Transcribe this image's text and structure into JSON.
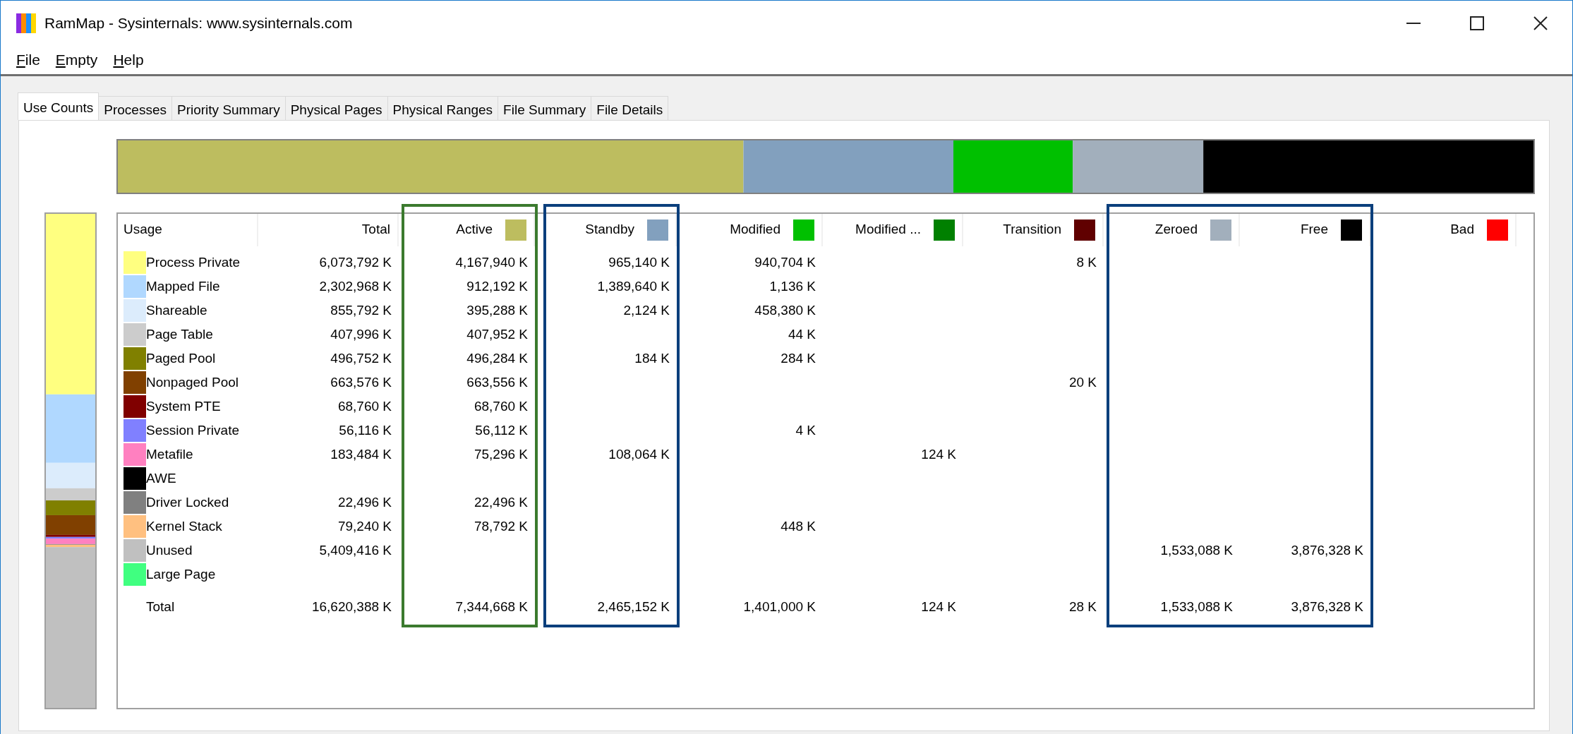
{
  "window": {
    "title": "RamMap - Sysinternals: www.sysinternals.com"
  },
  "menu": [
    {
      "label": "File"
    },
    {
      "label": "Empty"
    },
    {
      "label": "Help"
    }
  ],
  "tabs": [
    {
      "label": "Use Counts",
      "selected": true
    },
    {
      "label": "Processes",
      "selected": false
    },
    {
      "label": "Priority Summary",
      "selected": false
    },
    {
      "label": "Physical Pages",
      "selected": false
    },
    {
      "label": "Physical Ranges",
      "selected": false
    },
    {
      "label": "File Summary",
      "selected": false
    },
    {
      "label": "File Details",
      "selected": false
    }
  ],
  "table": {
    "columns": [
      {
        "label": "Usage"
      },
      {
        "label": "Total"
      },
      {
        "label": "Active",
        "color": "#bdbd5f",
        "frame": {
          "color": "#3b7a2e"
        }
      },
      {
        "label": "Standby",
        "color": "#82a0be",
        "frame": {
          "color": "#0b3f7c"
        }
      },
      {
        "label": "Modified",
        "color": "#00c000"
      },
      {
        "label": "Modified ...",
        "color": "#008000"
      },
      {
        "label": "Transition",
        "color": "#600000"
      },
      {
        "label": "Zeroed",
        "color": "#a2afbc",
        "frame": {
          "color": "#0b3f7c"
        }
      },
      {
        "label": "Free",
        "color": "#000000",
        "frame": {
          "color": "#0b3f7c"
        }
      },
      {
        "label": "Bad",
        "color": "#ff0000"
      }
    ],
    "rows": [
      {
        "usage": "Process Private",
        "color": "#ffff80",
        "total": "6,073,792 K",
        "active": "4,167,940 K",
        "standby": "965,140 K",
        "modified": "940,704 K",
        "transition": "8 K"
      },
      {
        "usage": "Mapped File",
        "color": "#b0d8ff",
        "total": "2,302,968 K",
        "active": "912,192 K",
        "standby": "1,389,640 K",
        "modified": "1,136 K"
      },
      {
        "usage": "Shareable",
        "color": "#dcecfc",
        "total": "855,792 K",
        "active": "395,288 K",
        "standby": "2,124 K",
        "modified": "458,380 K"
      },
      {
        "usage": "Page Table",
        "color": "#cccccc",
        "total": "407,996 K",
        "active": "407,952 K",
        "modified": "44 K"
      },
      {
        "usage": "Paged Pool",
        "color": "#808000",
        "total": "496,752 K",
        "active": "496,284 K",
        "standby": "184 K",
        "modified": "284 K"
      },
      {
        "usage": "Nonpaged Pool",
        "color": "#804000",
        "total": "663,576 K",
        "active": "663,556 K",
        "transition": "20 K"
      },
      {
        "usage": "System PTE",
        "color": "#800000",
        "total": "68,760 K",
        "active": "68,760 K"
      },
      {
        "usage": "Session Private",
        "color": "#8080ff",
        "total": "56,116 K",
        "active": "56,112 K",
        "modified": "4 K"
      },
      {
        "usage": "Metafile",
        "color": "#ff80c0",
        "total": "183,484 K",
        "active": "75,296 K",
        "standby": "108,064 K",
        "modified_no_write": "124 K"
      },
      {
        "usage": "AWE",
        "color": "#000000"
      },
      {
        "usage": "Driver Locked",
        "color": "#808080",
        "total": "22,496 K",
        "active": "22,496 K"
      },
      {
        "usage": "Kernel Stack",
        "color": "#ffc080",
        "total": "79,240 K",
        "active": "78,792 K",
        "modified": "448 K"
      },
      {
        "usage": "Unused",
        "color": "#c0c0c0",
        "total": "5,409,416 K",
        "zeroed": "1,533,088 K",
        "free": "3,876,328 K"
      },
      {
        "usage": "Large Page",
        "color": "#40ff80"
      }
    ],
    "total_row": {
      "usage": "Total",
      "total": "16,620,388 K",
      "active": "7,344,668 K",
      "standby": "2,465,152 K",
      "modified": "1,401,000 K",
      "modified_no_write": "124 K",
      "transition": "28 K",
      "zeroed": "1,533,088 K",
      "free": "3,876,328 K"
    }
  }
}
